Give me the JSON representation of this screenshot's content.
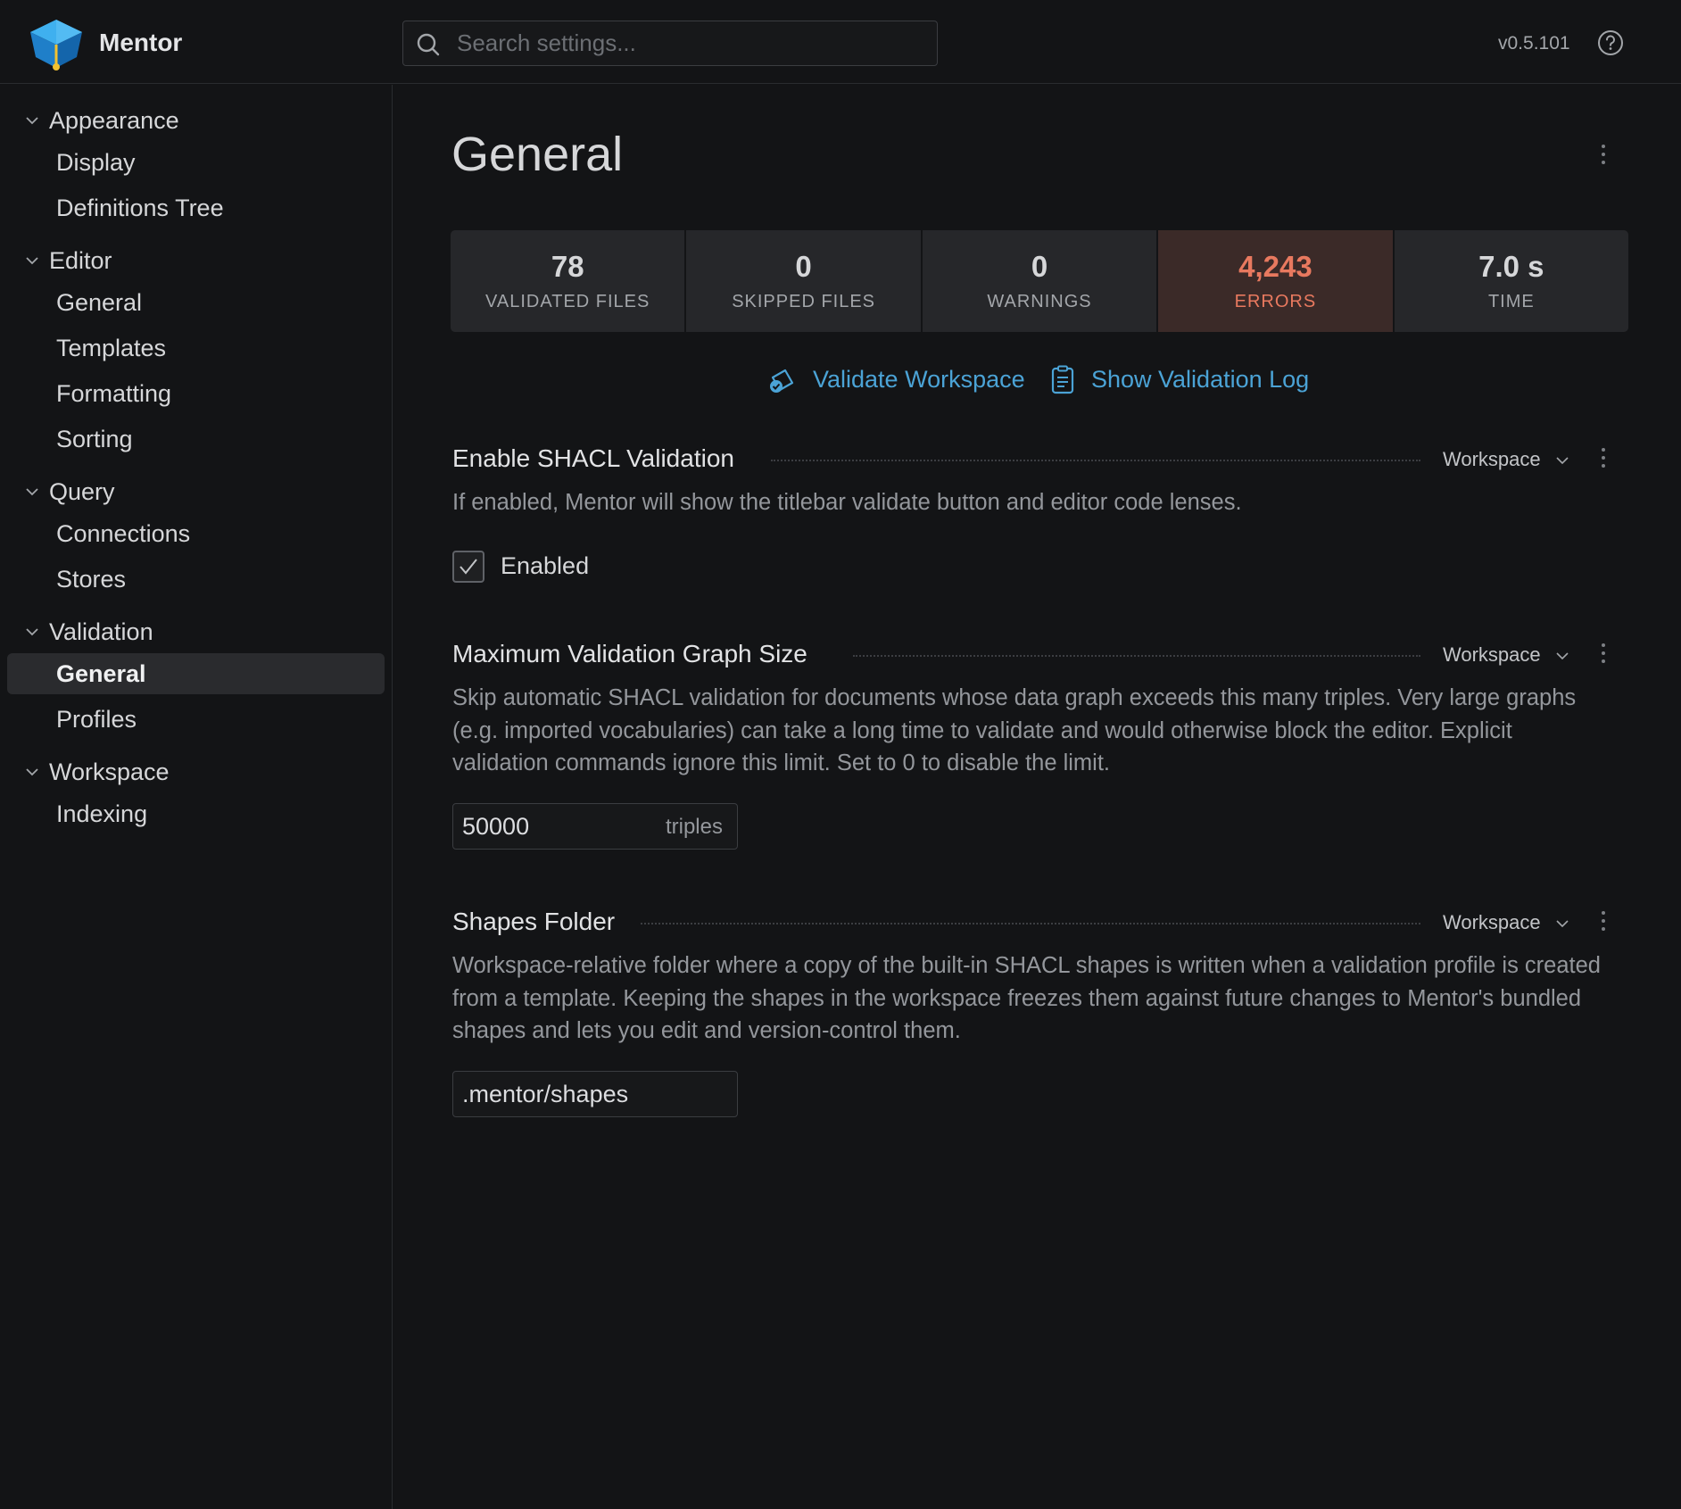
{
  "header": {
    "app_name": "Mentor",
    "search_placeholder": "Search settings...",
    "version": "v0.5.101"
  },
  "sidebar": {
    "groups": [
      {
        "label": "Appearance",
        "items": [
          "Display",
          "Definitions Tree"
        ]
      },
      {
        "label": "Editor",
        "items": [
          "General",
          "Templates",
          "Formatting",
          "Sorting"
        ]
      },
      {
        "label": "Query",
        "items": [
          "Connections",
          "Stores"
        ]
      },
      {
        "label": "Validation",
        "items": [
          "General",
          "Profiles"
        ]
      },
      {
        "label": "Workspace",
        "items": [
          "Indexing"
        ]
      }
    ],
    "active": "Validation / General"
  },
  "main": {
    "title": "General",
    "stats": [
      {
        "value": "78",
        "caption": "VALIDATED FILES"
      },
      {
        "value": "0",
        "caption": "SKIPPED FILES"
      },
      {
        "value": "0",
        "caption": "WARNINGS"
      },
      {
        "value": "4,243",
        "caption": "ERRORS"
      },
      {
        "value": "7.0 s",
        "caption": "TIME"
      }
    ],
    "actions": {
      "validate": "Validate Workspace",
      "show_log": "Show Validation Log"
    },
    "settings": {
      "shacl": {
        "title": "Enable SHACL Validation",
        "scope": "Workspace",
        "description": "If enabled, Mentor will show the titlebar validate button and editor code lenses.",
        "checkbox_label": "Enabled",
        "checked": true
      },
      "max_graph": {
        "title": "Maximum Validation Graph Size",
        "scope": "Workspace",
        "description": "Skip automatic SHACL validation for documents whose data graph exceeds this many triples. Very large graphs (e.g. imported vocabularies) can take a long time to validate and would otherwise block the editor. Explicit validation commands ignore this limit. Set to 0 to disable the limit.",
        "value": "50000",
        "unit": "triples"
      },
      "shapes_folder": {
        "title": "Shapes Folder",
        "scope": "Workspace",
        "description": "Workspace-relative folder where a copy of the built-in SHACL shapes is written when a validation profile is created from a template. Keeping the shapes in the workspace freezes them against future changes to Mentor's bundled shapes and lets you edit and version-control them.",
        "value": ".mentor/shapes"
      }
    }
  },
  "colors": {
    "background": "#131416",
    "accent": "#4ba3d6",
    "error": "#e8795f",
    "stat_bg": "#26272a"
  },
  "icons": [
    "mentor-logo-icon",
    "search-icon",
    "help-circle-icon",
    "chevron-down-icon",
    "kebab-menu-icon",
    "validate-icon",
    "log-icon",
    "check-icon"
  ]
}
